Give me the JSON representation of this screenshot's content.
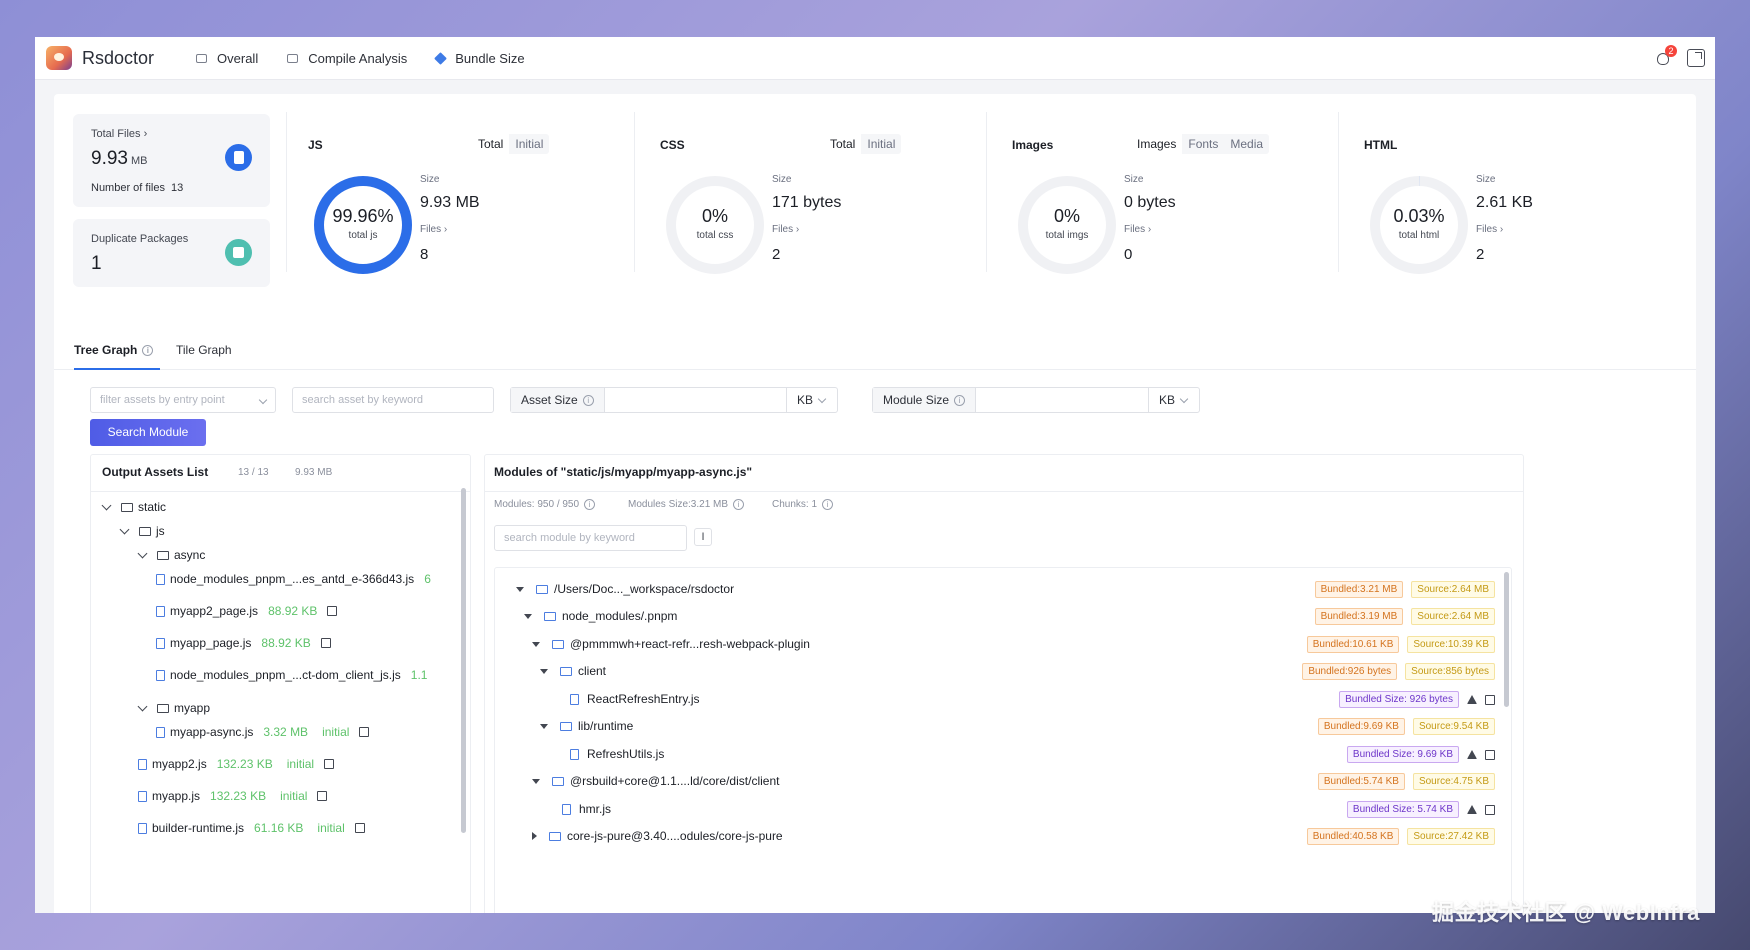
{
  "app": {
    "name": "Rsdoctor"
  },
  "nav": [
    {
      "label": "Overall",
      "icon": "overview-icon"
    },
    {
      "label": "Compile Analysis",
      "icon": "compile-icon"
    },
    {
      "label": "Bundle Size",
      "icon": "cube-icon"
    }
  ],
  "header": {
    "notification_count": "2"
  },
  "overview": {
    "total_files": {
      "label": "Total Files",
      "value": "9.93",
      "unit": "MB",
      "count_label": "Number of files",
      "count": "13"
    },
    "duplicate_packages": {
      "label": "Duplicate Packages",
      "value": "1"
    },
    "js": {
      "title": "JS",
      "toggle": [
        "Total",
        "Initial"
      ],
      "percent_text": "99.96%",
      "percent": 99.96,
      "center_label": "total js",
      "size_label": "Size",
      "size": "9.93 MB",
      "files_label": "Files",
      "files": "8"
    },
    "css": {
      "title": "CSS",
      "toggle": [
        "Total",
        "Initial"
      ],
      "percent_text": "0%",
      "percent": 0,
      "center_label": "total css",
      "size_label": "Size",
      "size": "171 bytes",
      "files_label": "Files",
      "files": "2"
    },
    "images": {
      "title": "Images",
      "toggle": [
        "Images",
        "Fonts",
        "Media"
      ],
      "percent_text": "0%",
      "percent": 0,
      "center_label": "total imgs",
      "size_label": "Size",
      "size": "0 bytes",
      "files_label": "Files",
      "files": "0"
    },
    "html": {
      "title": "HTML",
      "percent_text": "0.03%",
      "percent": 0.03,
      "center_label": "total html",
      "size_label": "Size",
      "size": "2.61 KB",
      "files_label": "Files",
      "files": "2"
    }
  },
  "graph_tabs": {
    "tree": "Tree Graph",
    "tile": "Tile Graph"
  },
  "filters": {
    "entry_placeholder": "filter assets by entry point",
    "keyword_placeholder": "search asset by keyword",
    "asset_size_label": "Asset Size",
    "asset_unit": "KB",
    "module_size_label": "Module Size",
    "module_unit": "KB",
    "search_button": "Search Module"
  },
  "assets": {
    "title": "Output Assets List",
    "count": "13 / 13",
    "size": "9.93 MB",
    "tree": {
      "static": "static",
      "js": "js",
      "async": "async",
      "f1": {
        "name": "node_modules_pnpm_...es_antd_e-366d43.js",
        "size": "6"
      },
      "f2": {
        "name": "myapp2_page.js",
        "size": "88.92 KB"
      },
      "f3": {
        "name": "myapp_page.js",
        "size": "88.92 KB"
      },
      "f4": {
        "name": "node_modules_pnpm_...ct-dom_client_js.js",
        "size": "1.1"
      },
      "myapp": "myapp",
      "f5": {
        "name": "myapp-async.js",
        "size": "3.32 MB",
        "tag": "initial"
      },
      "f6": {
        "name": "myapp2.js",
        "size": "132.23 KB",
        "tag": "initial"
      },
      "f7": {
        "name": "myapp.js",
        "size": "132.23 KB",
        "tag": "initial"
      },
      "f8": {
        "name": "builder-runtime.js",
        "size": "61.16 KB",
        "tag": "initial"
      }
    }
  },
  "modules": {
    "title": "Modules of \"static/js/myapp/myapp-async.js\"",
    "meta_modules": "Modules: 950 / 950",
    "meta_size": "Modules Size:3.21 MB",
    "meta_chunks": "Chunks: 1",
    "search_placeholder": "search module by keyword",
    "expand_icon": "I",
    "rows": [
      {
        "name": "/Users/Doc..._workspace/rsdoctor",
        "bundled": "Bundled:3.21 MB",
        "source": "Source:2.64 MB"
      },
      {
        "name": "node_modules/.pnpm",
        "bundled": "Bundled:3.19 MB",
        "source": "Source:2.64 MB"
      },
      {
        "name": "@pmmmwh+react-refr...resh-webpack-plugin",
        "bundled": "Bundled:10.61 KB",
        "source": "Source:10.39 KB"
      },
      {
        "name": "client",
        "bundled": "Bundled:926 bytes",
        "source": "Source:856 bytes"
      },
      {
        "name": "ReactRefreshEntry.js",
        "bundled": "Bundled Size: 926 bytes"
      },
      {
        "name": "lib/runtime",
        "bundled": "Bundled:9.69 KB",
        "source": "Source:9.54 KB"
      },
      {
        "name": "RefreshUtils.js",
        "bundled": "Bundled Size: 9.69 KB"
      },
      {
        "name": "@rsbuild+core@1.1....ld/core/dist/client",
        "bundled": "Bundled:5.74 KB",
        "source": "Source:4.75 KB"
      },
      {
        "name": "hmr.js",
        "bundled": "Bundled Size: 5.74 KB"
      },
      {
        "name": "core-js-pure@3.40....odules/core-js-pure",
        "bundled": "Bundled:40.58 KB",
        "source": "Source:27.42 KB"
      }
    ]
  },
  "watermark": "掘金技术社区 @ WebInfra",
  "colors": {
    "accent": "#2b6de8",
    "ring_track": "#f0f1f4",
    "green": "#5ec26a"
  }
}
